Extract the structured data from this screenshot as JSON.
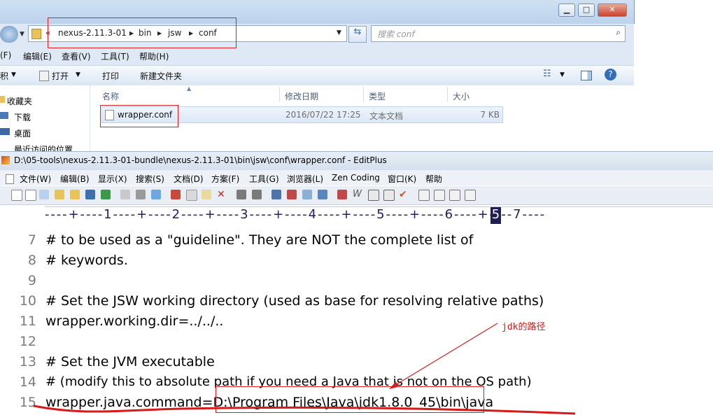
{
  "explorer": {
    "address_segments": [
      "«",
      "nexus-2.11.3-01",
      "bin",
      "jsw",
      "conf"
    ],
    "search_placeholder": "搜索 conf",
    "menu": [
      "(F)",
      "编辑(E)",
      "查看(V)",
      "工具(T)",
      "帮助(H)"
    ],
    "toolbar": {
      "organize": "积",
      "open": "打开",
      "print": "打印",
      "new_folder": "新建文件夹"
    },
    "nav": [
      "收藏夹",
      "下载",
      "桌面",
      "最近访问的位置"
    ],
    "columns": [
      "名称",
      "修改日期",
      "类型",
      "大小"
    ],
    "file": {
      "name": "wrapper.conf",
      "date": "2016/07/22 17:25",
      "type": "文本文档",
      "size": "7 KB"
    }
  },
  "editplus": {
    "title": "D:\\05-tools\\nexus-2.11.3-01-bundle\\nexus-2.11.3-01\\bin\\jsw\\conf\\wrapper.conf - EditPlus",
    "menu": [
      "文件(W)",
      "编辑(B)",
      "显示(X)",
      "搜索(S)",
      "文档(D)",
      "方案(F)",
      "工具(G)",
      "浏览器(L)",
      "Zen Coding",
      "窗口(K)",
      "帮助"
    ],
    "ruler": "----+----1----+----2----+----3----+----4----+----5----+----6----+----7----",
    "lines": [
      {
        "num": "7",
        "text": "# to be used as a \"guideline\". They are NOT the complete list of"
      },
      {
        "num": "8",
        "text": "# keywords."
      },
      {
        "num": "9",
        "text": ""
      },
      {
        "num": "10",
        "text": "# Set the JSW working directory (used as base for resolving relative paths)"
      },
      {
        "num": "11",
        "text": "wrapper.working.dir=../../.."
      },
      {
        "num": "12",
        "text": ""
      },
      {
        "num": "13",
        "text": "# Set the JVM executable"
      },
      {
        "num": "14",
        "text": "# (modify this to absolute path if you need a Java that is not on the OS path)"
      },
      {
        "num": "15",
        "text": "wrapper.java.command=D:\\Program Files\\Java\\jdk1.8.0_45\\bin\\java"
      }
    ],
    "annotation": "jdk的路径"
  }
}
